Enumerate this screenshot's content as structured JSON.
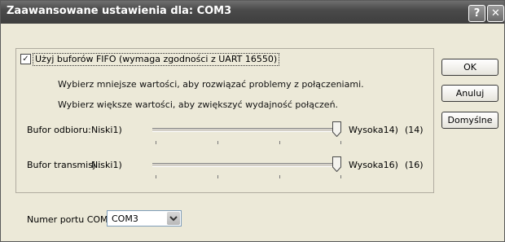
{
  "window": {
    "title": "Zaawansowane ustawienia dla: COM3",
    "help_icon": "question-mark-icon",
    "close_icon": "close-x-icon"
  },
  "fifo": {
    "checked": true,
    "label": "Użyj buforów FIFO (wymaga zgodności z UART 16550)"
  },
  "hints": {
    "line1": "Wybierz mniejsze wartości, aby rozwiązać problemy z połączeniami.",
    "line2": "Wybierz większe wartości, aby zwiększyć wydajność połączeń."
  },
  "receive": {
    "label": "Bufor odbioru:",
    "low": "Niski1)",
    "high": "Wysoka14)",
    "value": "(14)",
    "level": 1.0
  },
  "transmit": {
    "label": "Bufor transmisji:",
    "low": "Niski1)",
    "high": "Wysoka16)",
    "value": "(16)",
    "level": 1.0
  },
  "buttons": {
    "ok": "OK",
    "cancel": "Anuluj",
    "defaults": "Domyślne"
  },
  "port": {
    "label": "Numer portu COM:",
    "value": "COM3"
  }
}
